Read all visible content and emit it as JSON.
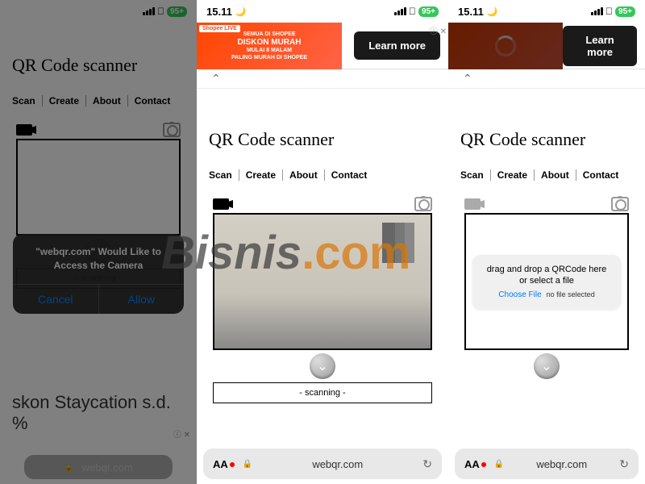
{
  "status": {
    "time": "15.11",
    "battery": "95+"
  },
  "page": {
    "title": "QR Code scanner",
    "nav": [
      "Scan",
      "Create",
      "About",
      "Contact"
    ],
    "scanning": "- scanning -"
  },
  "dialog": {
    "text": "\"webqr.com\" Would Like to Access the Camera",
    "cancel": "Cancel",
    "allow": "Allow"
  },
  "ad": {
    "shopee": "Shopee LIVE",
    "line1": "SEMUA DI SHOPEE",
    "line2": "DISKON MURAH",
    "line3": "MULAI 8 MALAM",
    "line4": "PALING MURAH DI SHOPEE",
    "learn": "Learn more",
    "promo": "skon Staycation s.d.\n%"
  },
  "drop": {
    "line1": "drag and drop a QRCode here",
    "line2": "or select a file",
    "choose": "Choose File",
    "none": "no file selected"
  },
  "safari": {
    "aa": "AA",
    "url": "webqr.com"
  },
  "watermark": {
    "brand": "Bisnis",
    "dot": ".",
    "tld": "com"
  }
}
